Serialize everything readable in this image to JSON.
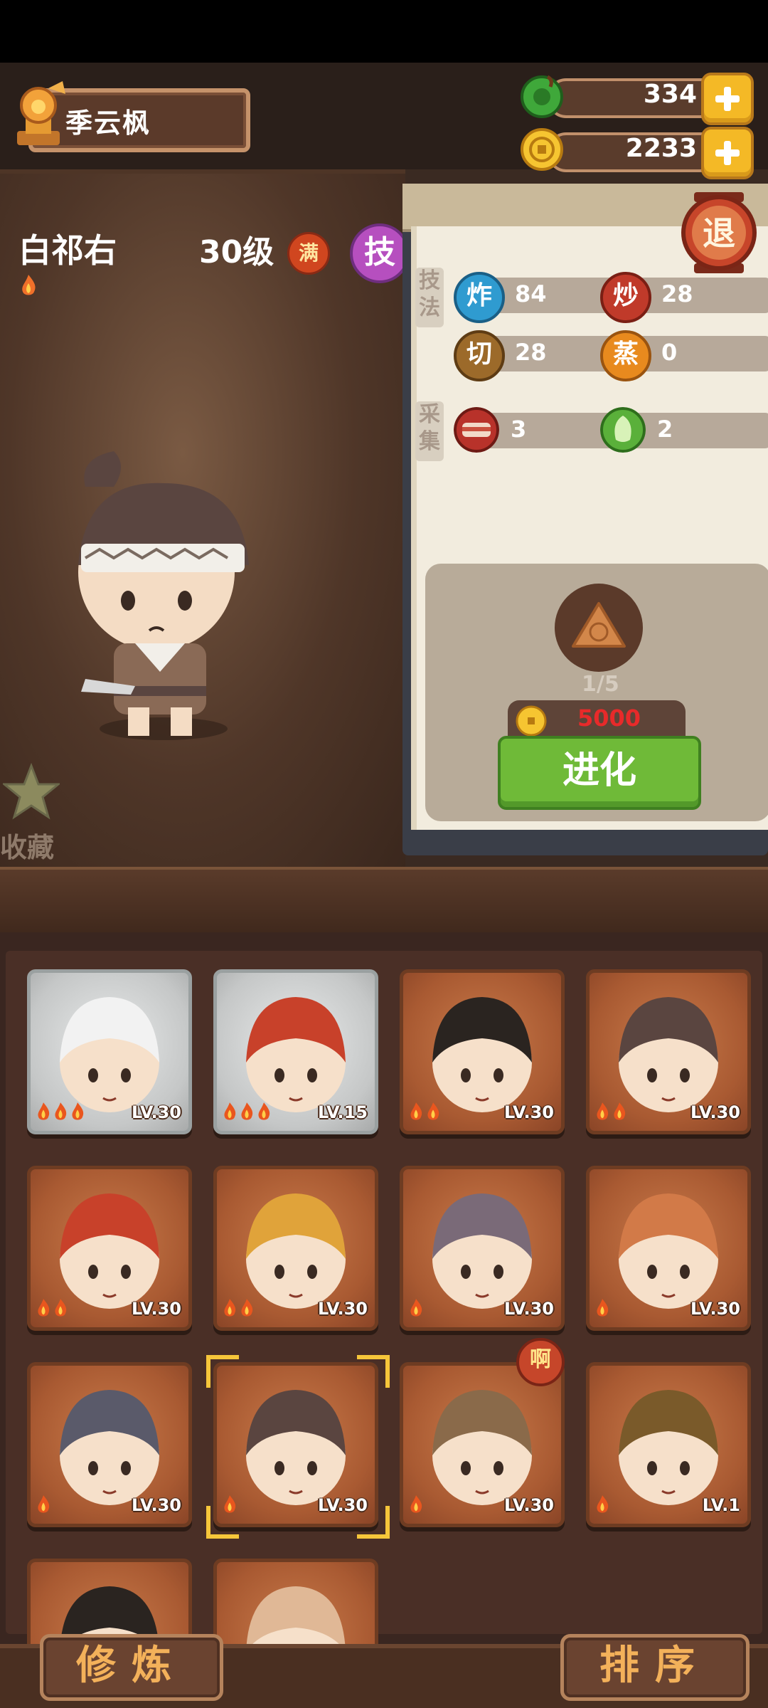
{
  "player": {
    "name": "季云枫"
  },
  "resources": {
    "jade": "334",
    "coins": "2233"
  },
  "character": {
    "name": "白祁右",
    "level": "30级",
    "full_badge": "满",
    "skill_badge": "技",
    "favorite_label": "收藏"
  },
  "panel": {
    "retreat_label": "退",
    "technique_label": "技法",
    "gather_label": "采集",
    "techniques": [
      {
        "icon": "炸",
        "value": "84",
        "color": "#2f9bd0"
      },
      {
        "icon": "炒",
        "value": "28",
        "color": "#c03a2a"
      },
      {
        "icon": "切",
        "value": "28",
        "color": "#9c6a2a"
      },
      {
        "icon": "蒸",
        "value": "0",
        "color": "#e88a1e"
      }
    ],
    "gather": [
      {
        "icon": "meat-icon",
        "value": "3"
      },
      {
        "icon": "vegetable-icon",
        "value": "2"
      }
    ],
    "evolve": {
      "progress": "1/5",
      "cost": "5000",
      "button_label": "进化"
    }
  },
  "roster": [
    {
      "level": "LV.30",
      "flames": 3,
      "frame": "silver"
    },
    {
      "level": "LV.15",
      "flames": 3,
      "frame": "silver"
    },
    {
      "level": "LV.30",
      "flames": 2,
      "frame": "bronze"
    },
    {
      "level": "LV.30",
      "flames": 2,
      "frame": "bronze"
    },
    {
      "level": "LV.30",
      "flames": 2,
      "frame": "bronze"
    },
    {
      "level": "LV.30",
      "flames": 2,
      "frame": "bronze"
    },
    {
      "level": "LV.30",
      "flames": 1,
      "frame": "bronze"
    },
    {
      "level": "LV.30",
      "flames": 1,
      "frame": "bronze"
    },
    {
      "level": "LV.30",
      "flames": 1,
      "frame": "bronze"
    },
    {
      "level": "LV.30",
      "flames": 1,
      "frame": "bronze",
      "selected": true
    },
    {
      "level": "LV.30",
      "flames": 1,
      "frame": "bronze"
    },
    {
      "level": "LV.1",
      "flames": 1,
      "frame": "bronze"
    },
    {
      "level": "",
      "flames": 0,
      "frame": "bronze"
    },
    {
      "level": "",
      "flames": 0,
      "frame": "bronze"
    }
  ],
  "speech_bubble": "啊",
  "bottom": {
    "cultivate_label": "修炼",
    "sort_label": "排序"
  }
}
